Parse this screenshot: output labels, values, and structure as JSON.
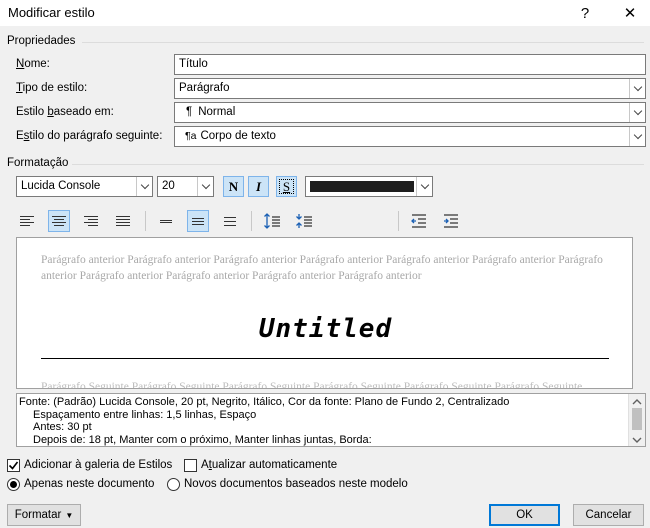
{
  "window": {
    "title": "Modificar estilo",
    "help": "?",
    "close": "✕"
  },
  "properties": {
    "section_label": "Propriedades",
    "name": {
      "label_u": "N",
      "label_rest": "ome:",
      "value": "Título"
    },
    "style_type": {
      "label_u": "T",
      "label_rest": "ipo de estilo:",
      "value": "Parágrafo"
    },
    "based_on": {
      "label_pre": "Estilo ",
      "label_u": "b",
      "label_rest": "aseado em:",
      "glyph": "¶",
      "value": "Normal"
    },
    "next_style": {
      "label_pre": "E",
      "label_u": "s",
      "label_rest": "tilo do parágrafo seguinte:",
      "glyph": "¶a",
      "value": "Corpo de texto"
    }
  },
  "formatting": {
    "section_label": "Formatação",
    "font": "Lucida Console",
    "size": "20",
    "bold": "N",
    "italic": "I",
    "underline": "S",
    "color": "#1e1e1e"
  },
  "preview": {
    "previous_text": "Parágrafo anterior Parágrafo anterior Parágrafo anterior Parágrafo anterior Parágrafo anterior Parágrafo anterior Parágrafo anterior Parágrafo anterior Parágrafo anterior Parágrafo anterior Parágrafo anterior",
    "sample": "Untitled",
    "following_text": "Parágrafo Seguinte Parágrafo Seguinte Parágrafo Seguinte Parágrafo Seguinte Parágrafo Seguinte Parágrafo Seguinte"
  },
  "description": {
    "line1": "Fonte: (Padrão) Lucida Console, 20 pt, Negrito, Itálico, Cor da fonte: Plano de Fundo 2, Centralizado",
    "line2": "Espaçamento entre linhas:  1,5 linhas, Espaço",
    "line3": "Antes:  30 pt",
    "line4": "Depois de:  18 pt, Manter com o próximo, Manter linhas juntas, Borda:"
  },
  "options": {
    "add_gallery": "Adicionar à galeria de Estilos",
    "auto_update_u": "t",
    "auto_update_pre": "A",
    "auto_update_rest": "ualizar automaticamente",
    "only_doc": "Apenas neste documento",
    "new_docs": "Novos documentos baseados neste modelo"
  },
  "buttons": {
    "format": "Formatar",
    "ok": "OK",
    "cancel": "Cancelar"
  }
}
